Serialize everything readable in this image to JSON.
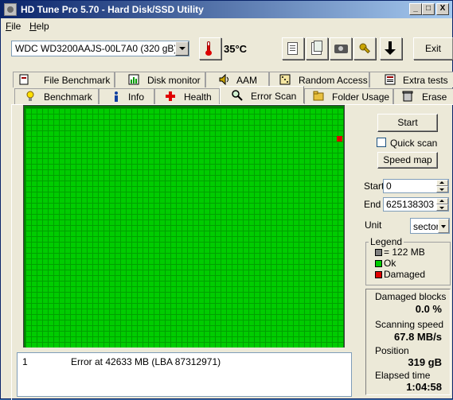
{
  "window": {
    "title": "HD Tune Pro 5.70 - Hard Disk/SSD Utility",
    "controls": {
      "minimize": "_",
      "maximize": "□",
      "close": "X"
    }
  },
  "menu": [
    {
      "label": "File",
      "accel": "F",
      "rest": "ile"
    },
    {
      "label": "Help",
      "accel": "H",
      "rest": "elp"
    }
  ],
  "toolbar": {
    "drive": "WDC WD3200AAJS-00L7A0 (320 gB)",
    "temperature": "35°C",
    "exit_label": "Exit",
    "icons": [
      "copy-text-icon",
      "copy-screenshot-icon",
      "camera-icon",
      "options-icon",
      "save-icon"
    ]
  },
  "tabs_row1": [
    {
      "label": "File Benchmark",
      "icon": "file-benchmark-icon"
    },
    {
      "label": "Disk monitor",
      "icon": "disk-monitor-icon"
    },
    {
      "label": "AAM",
      "icon": "speaker-icon"
    },
    {
      "label": "Random Access",
      "icon": "dice-icon"
    },
    {
      "label": "Extra tests",
      "icon": "extra-tests-icon"
    }
  ],
  "tabs_row2": [
    {
      "label": "Benchmark",
      "icon": "lightbulb-icon"
    },
    {
      "label": "Info",
      "icon": "info-icon"
    },
    {
      "label": "Health",
      "icon": "health-cross-icon"
    },
    {
      "label": "Error Scan",
      "icon": "magnifier-icon",
      "active": true
    },
    {
      "label": "Folder Usage",
      "icon": "folder-icon"
    },
    {
      "label": "Erase",
      "icon": "trash-icon"
    }
  ],
  "scan": {
    "start_button": "Start",
    "quick_scan_label": "Quick scan",
    "quick_scan_checked": false,
    "speed_map_button": "Speed map",
    "start_label": "Start",
    "start_value": "0",
    "end_label": "End",
    "end_value": "625138303",
    "unit_label": "Unit",
    "unit_value": "sector"
  },
  "legend": {
    "title": "Legend",
    "items": [
      {
        "label": "= 122 MB",
        "color": "#808080"
      },
      {
        "label": "Ok",
        "color": "#00cc00"
      },
      {
        "label": "Damaged",
        "color": "#e00000"
      }
    ]
  },
  "stats": {
    "damaged_label": "Damaged blocks",
    "damaged_value": "0.0 %",
    "speed_label": "Scanning speed",
    "speed_value": "67.8 MB/s",
    "position_label": "Position",
    "position_value": "319 gB",
    "elapsed_label": "Elapsed time",
    "elapsed_value": "1:04:58"
  },
  "log": [
    {
      "num": "1",
      "text": "Error at 42633 MB (LBA 87312971)"
    }
  ],
  "colors": {
    "ok": "#00cc00",
    "damaged": "#e00000",
    "grid": "#00a000"
  }
}
